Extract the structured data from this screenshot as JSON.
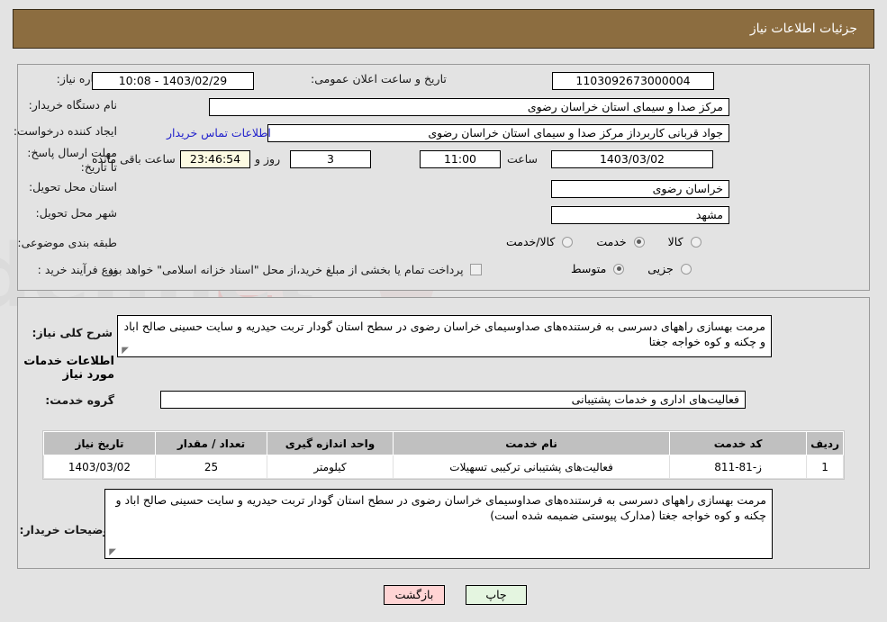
{
  "header": {
    "title": "جزئیات اطلاعات نیاز"
  },
  "basic_info": {
    "need_number_label": "شماره نیاز:",
    "need_number_value": "1103092673000004",
    "announce_label": "تاریخ و ساعت اعلان عمومی:",
    "announce_value": "1403/02/29 - 10:08",
    "buyer_org_label": "نام دستگاه خریدار:",
    "buyer_org_value": "مرکز صدا و سیمای استان خراسان رضوی",
    "requester_label": "ایجاد کننده درخواست:",
    "requester_value": "جواد قربانی کاربرداز مرکز صدا و سیمای استان خراسان رضوی",
    "contact_link": "اطلاعات تماس خریدار",
    "deadline_label": "مهلت ارسال پاسخ: تا تاریخ:",
    "deadline_date": "1403/03/02",
    "hour_label": "ساعت",
    "hour_value": "11:00",
    "days_value": "3",
    "days_label": "روز و",
    "remaining_time": "23:46:54",
    "remaining_label": "ساعت باقی مانده",
    "province_label": "استان محل تحویل:",
    "province_value": "خراسان رضوی",
    "city_label": "شهر محل تحویل:",
    "city_value": "مشهد",
    "category_label": "طبقه بندی موضوعی:",
    "category_options": [
      {
        "label": "کالا",
        "selected": false
      },
      {
        "label": "خدمت",
        "selected": true
      },
      {
        "label": "کالا/خدمت",
        "selected": false
      }
    ],
    "process_label": "نوع فرآیند خرید :",
    "process_options": [
      {
        "label": "جزیی",
        "selected": false
      },
      {
        "label": "متوسط",
        "selected": true
      }
    ],
    "treasury_checkbox_label": "پرداخت تمام یا بخشی از مبلغ خرید،از محل \"اسناد خزانه اسلامی\" خواهد بود.",
    "treasury_checked": false
  },
  "details": {
    "need_desc_label": "شرح کلی نیاز:",
    "need_desc_value": "مرمت بهسازی راههای دسرسی به فرستنده‌های صداوسیمای خراسان رضوی در سطح استان گودار تربت حیدریه و سایت حسینی صالح اباد و چکنه و کوه خواجه جغتا",
    "services_heading": "اطلاعات خدمات مورد نیاز",
    "service_group_label": "گروه خدمت:",
    "service_group_value": "فعالیت‌های اداری و خدمات پشتیبانی",
    "buyer_notes_label": "توضیحات خریدار:",
    "buyer_notes_value": "مرمت بهسازی راههای دسرسی به فرستنده‌های صداوسیمای خراسان رضوی در سطح استان گودار تربت حیدریه و سایت حسینی صالح اباد و چکنه و کوه خواجه جغتا (مدارک پیوستی ضمیمه شده است)"
  },
  "table": {
    "columns": [
      "ردیف",
      "کد خدمت",
      "نام خدمت",
      "واحد اندازه گیری",
      "تعداد / مقدار",
      "تاریخ نیاز"
    ],
    "rows": [
      {
        "index": "1",
        "code": "ز-81-811",
        "name": "فعالیت‌های پشتیبانی ترکیبی تسهیلات",
        "unit": "کیلومتر",
        "quantity": "25",
        "date": "1403/03/02"
      }
    ]
  },
  "footer": {
    "back_label": "بازگشت",
    "print_label": "چاپ"
  },
  "watermark": {
    "text": "AriaTender.net"
  },
  "colors": {
    "header_bg": "#8c6d40",
    "page_bg": "#e3e3e3",
    "link": "#2222cc",
    "back_btn": "#ffd4d4",
    "print_btn": "#e4f5e0",
    "highlight_field": "#fcfae2",
    "table_header": "#c0c0c0"
  }
}
